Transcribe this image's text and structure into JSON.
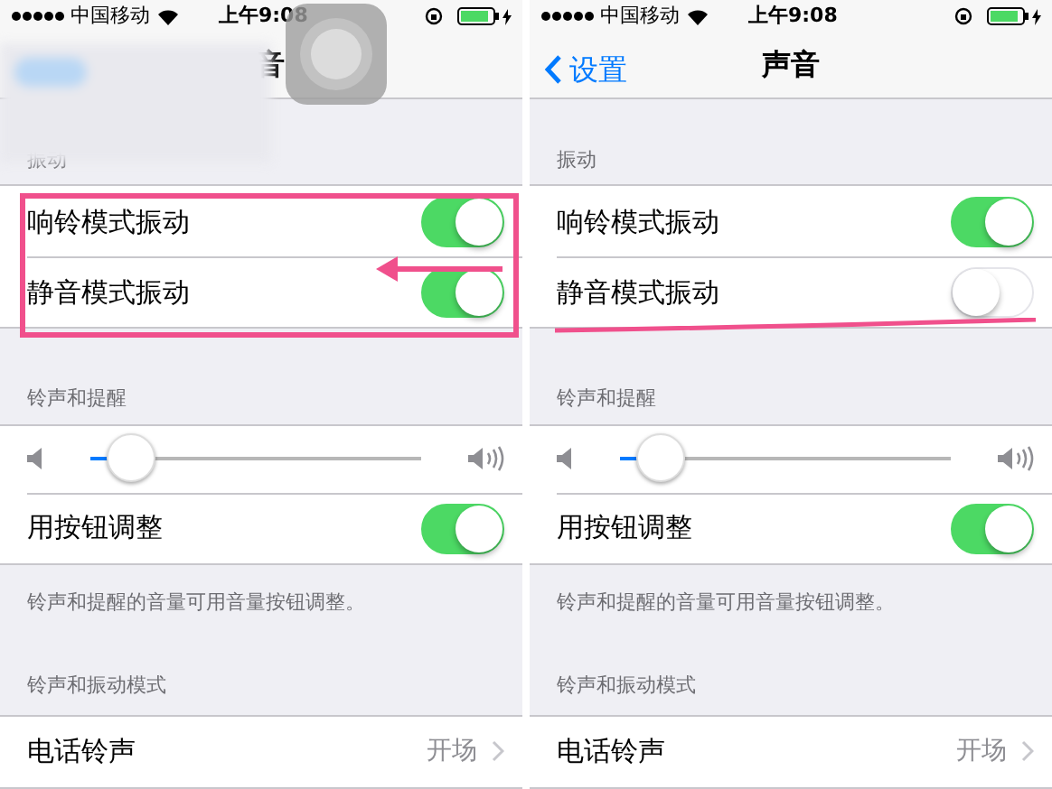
{
  "panels": [
    {
      "status_bar": {
        "carrier": "中国移动",
        "time": "上午9:08"
      },
      "nav": {
        "title": "音",
        "blurred": true
      },
      "overlay": {
        "kind": "assistive_touch"
      },
      "annotation": {
        "kind": "box_arrow"
      },
      "sections": [
        {
          "header": "振动",
          "rows": [
            {
              "kind": "toggle",
              "label": "响铃模式振动",
              "on": true
            },
            {
              "kind": "toggle",
              "label": "静音模式振动",
              "on": true
            }
          ]
        },
        {
          "header": "铃声和提醒",
          "rows": [
            {
              "kind": "slider",
              "level": 0.12
            },
            {
              "kind": "toggle",
              "label": "用按钮调整",
              "on": true
            }
          ],
          "footer": "铃声和提醒的音量可用音量按钮调整。"
        },
        {
          "header": "铃声和振动模式",
          "rows": [
            {
              "kind": "link",
              "label": "电话铃声",
              "value": "开场"
            }
          ]
        }
      ]
    },
    {
      "status_bar": {
        "carrier": "中国移动",
        "time": "上午9:08"
      },
      "nav": {
        "title": "声音",
        "back": "设置"
      },
      "annotation": {
        "kind": "underline"
      },
      "sections": [
        {
          "header": "振动",
          "rows": [
            {
              "kind": "toggle",
              "label": "响铃模式振动",
              "on": true
            },
            {
              "kind": "toggle",
              "label": "静音模式振动",
              "on": false
            }
          ]
        },
        {
          "header": "铃声和提醒",
          "rows": [
            {
              "kind": "slider",
              "level": 0.12
            },
            {
              "kind": "toggle",
              "label": "用按钮调整",
              "on": true
            }
          ],
          "footer": "铃声和提醒的音量可用音量按钮调整。"
        },
        {
          "header": "铃声和振动模式",
          "rows": [
            {
              "kind": "link",
              "label": "电话铃声",
              "value": "开场"
            }
          ]
        }
      ]
    }
  ]
}
